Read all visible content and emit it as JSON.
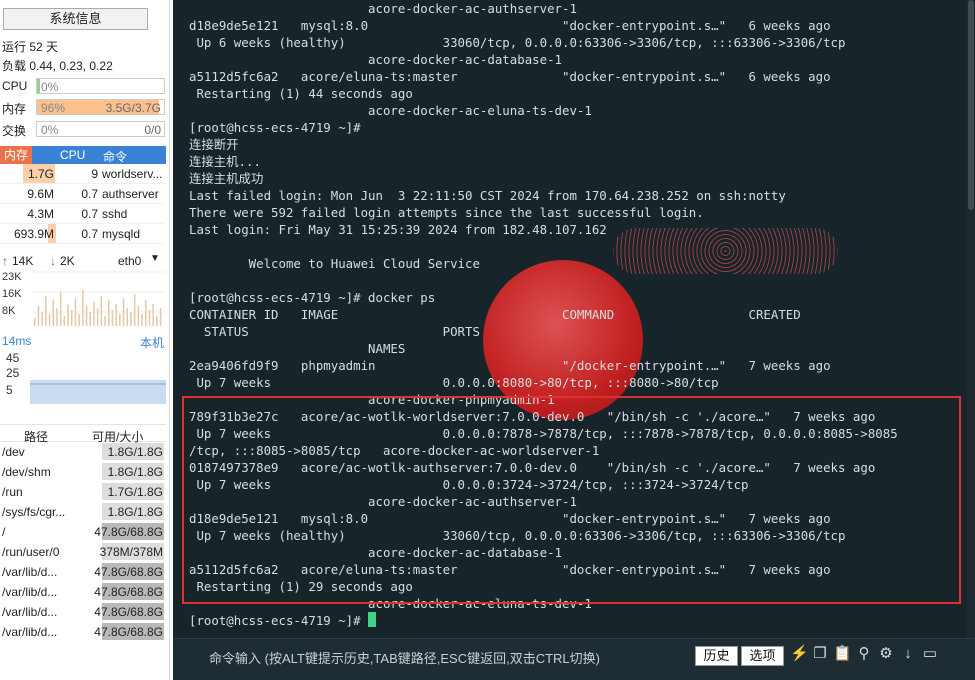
{
  "sidebar": {
    "sysinfo_button": "系统信息",
    "uptime": "运行 52 天",
    "load": "负载 0.44, 0.23, 0.22",
    "cpu": {
      "label": "CPU",
      "pct": "0%",
      "value": 0
    },
    "mem": {
      "label": "内存",
      "pct": "96%",
      "used": "3.5G/3.7G",
      "value": 96
    },
    "swap": {
      "label": "交换",
      "pct": "0%",
      "used": "0/0",
      "value": 0
    },
    "proc_headers": [
      "内存",
      "CPU",
      "命令"
    ],
    "processes": [
      {
        "mem": "1.7G",
        "cpu": "9",
        "cmd": "worldserv..."
      },
      {
        "mem": "9.6M",
        "cpu": "0.7",
        "cmd": "authserver"
      },
      {
        "mem": "4.3M",
        "cpu": "0.7",
        "cmd": "sshd"
      },
      {
        "mem": "693.9M",
        "cpu": "0.7",
        "cmd": "mysqld"
      }
    ],
    "net": {
      "up": "14K",
      "down": "2K",
      "iface": "eth0",
      "ticks": [
        "23K",
        "16K",
        "8K"
      ]
    },
    "latency": {
      "label": "14ms",
      "host": "本机",
      "ticks": [
        "45",
        "25",
        "5"
      ]
    },
    "disk_headers": [
      "路径",
      "可用/大小"
    ],
    "disks": [
      {
        "path": "/dev",
        "size": "1.8G/1.8G",
        "full": false
      },
      {
        "path": "/dev/shm",
        "size": "1.8G/1.8G",
        "full": false
      },
      {
        "path": "/run",
        "size": "1.7G/1.8G",
        "full": false
      },
      {
        "path": "/sys/fs/cgr...",
        "size": "1.8G/1.8G",
        "full": false
      },
      {
        "path": "/",
        "size": "47.8G/68.8G",
        "full": true
      },
      {
        "path": "/run/user/0",
        "size": "378M/378M",
        "full": false
      },
      {
        "path": "/var/lib/d...",
        "size": "47.8G/68.8G",
        "full": true
      },
      {
        "path": "/var/lib/d...",
        "size": "47.8G/68.8G",
        "full": true
      },
      {
        "path": "/var/lib/d...",
        "size": "47.8G/68.8G",
        "full": true
      },
      {
        "path": "/var/lib/d...",
        "size": "47.8G/68.8G",
        "full": true
      }
    ]
  },
  "terminal": {
    "output": "                        acore-docker-ac-authserver-1\nd18e9de5e121   mysql:8.0                          \"docker-entrypoint.s…\"   6 weeks ago\n Up 6 weeks (healthy)             33060/tcp, 0.0.0.0:63306->3306/tcp, :::63306->3306/tcp\n                        acore-docker-ac-database-1\na5112d5fc6a2   acore/eluna-ts:master              \"docker-entrypoint.s…\"   6 weeks ago\n Restarting (1) 44 seconds ago\n                        acore-docker-ac-eluna-ts-dev-1\n[root@hcss-ecs-4719 ~]#\n连接断开\n连接主机...\n连接主机成功\nLast failed login: Mon Jun  3 22:11:50 CST 2024 from 170.64.238.252 on ssh:notty\nThere were 592 failed login attempts since the last successful login.\nLast login: Fri May 31 15:25:39 2024 from 182.48.107.162\n\n        Welcome to Huawei Cloud Service\n\n[root@hcss-ecs-4719 ~]# docker ps\nCONTAINER ID   IMAGE                              COMMAND                  CREATED\n  STATUS                          PORTS\n                        NAMES\n2ea9406fd9f9   phpmyadmin                         \"/docker-entrypoint.…\"   7 weeks ago\n Up 7 weeks                       0.0.0.0:8080->80/tcp, :::8080->80/tcp\n                        acore-docker-phpmyadmin-1\n789f31b3e27c   acore/ac-wotlk-worldserver:7.0.0-dev.0   \"/bin/sh -c './acore…\"   7 weeks ago\n Up 7 weeks                       0.0.0.0:7878->7878/tcp, :::7878->7878/tcp, 0.0.0.0:8085->8085\n/tcp, :::8085->8085/tcp   acore-docker-ac-worldserver-1\n0187497378e9   acore/ac-wotlk-authserver:7.0.0-dev.0    \"/bin/sh -c './acore…\"   7 weeks ago\n Up 7 weeks                       0.0.0.0:3724->3724/tcp, :::3724->3724/tcp\n                        acore-docker-ac-authserver-1\nd18e9de5e121   mysql:8.0                          \"docker-entrypoint.s…\"   7 weeks ago\n Up 7 weeks (healthy)             33060/tcp, 0.0.0.0:63306->3306/tcp, :::63306->3306/tcp\n                        acore-docker-ac-database-1\na5112d5fc6a2   acore/eluna-ts:master              \"docker-entrypoint.s…\"   7 weeks ago\n Restarting (1) 29 seconds ago\n                        acore-docker-ac-eluna-ts-dev-1",
    "prompt": "[root@hcss-ecs-4719 ~]# "
  },
  "cmdbar": {
    "hint": "命令输入 (按ALT键提示历史,TAB键路径,ESC键返回,双击CTRL切换)",
    "history_button": "历史",
    "options_button": "选项",
    "icons": [
      "lightning-icon",
      "copy-icon",
      "paste-icon",
      "search-icon",
      "gear-icon",
      "download-icon",
      "window-icon"
    ]
  },
  "colors": {
    "accent": "#3a82d4",
    "terminal_bg": "#17252b",
    "highlight": "#e03131",
    "cursor": "#3fd38a"
  }
}
